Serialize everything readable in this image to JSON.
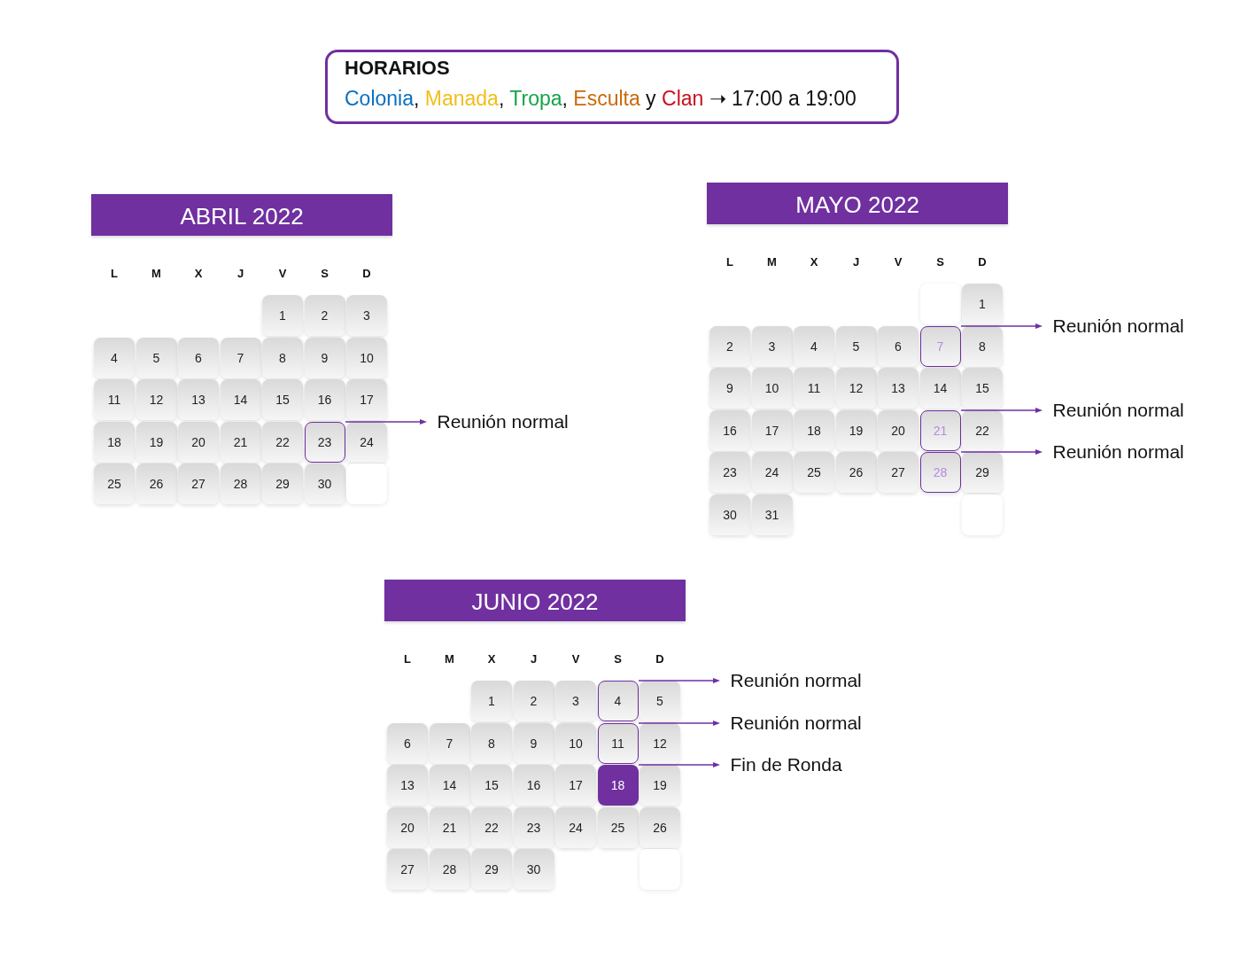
{
  "schedule": {
    "title": "HORARIOS",
    "segments": [
      {
        "text": "Colonia",
        "color": "#0b6fc2"
      },
      {
        "text": ", "
      },
      {
        "text": "Manada",
        "color": "#f2be1a"
      },
      {
        "text": ", "
      },
      {
        "text": "Tropa",
        "color": "#15a34a"
      },
      {
        "text": ", "
      },
      {
        "text": "Esculta",
        "color": "#c96a0c"
      },
      {
        "text": " y "
      },
      {
        "text": "Clan",
        "color": "#c8101e"
      },
      {
        "text": " ➝ 17:00 a 19:00"
      }
    ]
  },
  "months": [
    {
      "title": "ABRIL 2022",
      "weekdays": [
        "L",
        "M",
        "X",
        "J",
        "V",
        "S",
        "D"
      ],
      "days": [
        {
          "kind": "empty"
        },
        {
          "kind": "empty"
        },
        {
          "kind": "empty"
        },
        {
          "kind": "empty"
        },
        {
          "kind": "plain",
          "label": "1"
        },
        {
          "kind": "plain",
          "label": "2"
        },
        {
          "kind": "plain",
          "label": "3"
        },
        {
          "kind": "plain",
          "label": "4"
        },
        {
          "kind": "plain",
          "label": "5"
        },
        {
          "kind": "plain",
          "label": "6"
        },
        {
          "kind": "plain",
          "label": "7"
        },
        {
          "kind": "plain",
          "label": "8"
        },
        {
          "kind": "plain",
          "label": "9"
        },
        {
          "kind": "plain",
          "label": "10"
        },
        {
          "kind": "plain",
          "label": "11"
        },
        {
          "kind": "plain",
          "label": "12"
        },
        {
          "kind": "plain",
          "label": "13"
        },
        {
          "kind": "plain",
          "label": "14"
        },
        {
          "kind": "plain",
          "label": "15"
        },
        {
          "kind": "plain",
          "label": "16"
        },
        {
          "kind": "plain",
          "label": "17"
        },
        {
          "kind": "plain",
          "label": "18"
        },
        {
          "kind": "plain",
          "label": "19"
        },
        {
          "kind": "plain",
          "label": "20"
        },
        {
          "kind": "plain",
          "label": "21"
        },
        {
          "kind": "plain",
          "label": "22"
        },
        {
          "kind": "outlined",
          "label": "23",
          "note": "Reunión normal"
        },
        {
          "kind": "plain",
          "label": "24"
        },
        {
          "kind": "plain",
          "label": "25"
        },
        {
          "kind": "plain",
          "label": "26"
        },
        {
          "kind": "plain",
          "label": "27"
        },
        {
          "kind": "plain",
          "label": "28"
        },
        {
          "kind": "plain",
          "label": "29"
        },
        {
          "kind": "plain",
          "label": "30"
        },
        {
          "kind": "blank"
        }
      ]
    },
    {
      "title": "MAYO 2022",
      "weekdays": [
        "L",
        "M",
        "X",
        "J",
        "V",
        "S",
        "D"
      ],
      "days": [
        {
          "kind": "empty"
        },
        {
          "kind": "empty"
        },
        {
          "kind": "empty"
        },
        {
          "kind": "empty"
        },
        {
          "kind": "empty"
        },
        {
          "kind": "blank"
        },
        {
          "kind": "plain",
          "label": "1"
        },
        {
          "kind": "plain",
          "label": "2"
        },
        {
          "kind": "plain",
          "label": "3"
        },
        {
          "kind": "plain",
          "label": "4"
        },
        {
          "kind": "plain",
          "label": "5"
        },
        {
          "kind": "plain",
          "label": "6"
        },
        {
          "kind": "faded",
          "label": "7",
          "note": "Reunión normal"
        },
        {
          "kind": "plain",
          "label": "8"
        },
        {
          "kind": "plain",
          "label": "9"
        },
        {
          "kind": "plain",
          "label": "10"
        },
        {
          "kind": "plain",
          "label": "11"
        },
        {
          "kind": "plain",
          "label": "12"
        },
        {
          "kind": "plain",
          "label": "13"
        },
        {
          "kind": "plain",
          "label": "14"
        },
        {
          "kind": "plain",
          "label": "15"
        },
        {
          "kind": "plain",
          "label": "16"
        },
        {
          "kind": "plain",
          "label": "17"
        },
        {
          "kind": "plain",
          "label": "18"
        },
        {
          "kind": "plain",
          "label": "19"
        },
        {
          "kind": "plain",
          "label": "20"
        },
        {
          "kind": "faded",
          "label": "21",
          "note": "Reunión normal"
        },
        {
          "kind": "plain",
          "label": "22"
        },
        {
          "kind": "plain",
          "label": "23"
        },
        {
          "kind": "plain",
          "label": "24"
        },
        {
          "kind": "plain",
          "label": "25"
        },
        {
          "kind": "plain",
          "label": "26"
        },
        {
          "kind": "plain",
          "label": "27"
        },
        {
          "kind": "faded",
          "label": "28",
          "note": "Reunión normal"
        },
        {
          "kind": "plain",
          "label": "29"
        },
        {
          "kind": "plain",
          "label": "30"
        },
        {
          "kind": "plain",
          "label": "31"
        },
        {
          "kind": "empty"
        },
        {
          "kind": "empty"
        },
        {
          "kind": "empty"
        },
        {
          "kind": "empty"
        },
        {
          "kind": "blank"
        }
      ]
    },
    {
      "title": "JUNIO 2022",
      "weekdays": [
        "L",
        "M",
        "X",
        "J",
        "V",
        "S",
        "D"
      ],
      "days": [
        {
          "kind": "empty"
        },
        {
          "kind": "empty"
        },
        {
          "kind": "plain",
          "label": "1"
        },
        {
          "kind": "plain",
          "label": "2"
        },
        {
          "kind": "plain",
          "label": "3"
        },
        {
          "kind": "outlined",
          "label": "4",
          "note": "Reunión normal"
        },
        {
          "kind": "plain",
          "label": "5"
        },
        {
          "kind": "plain",
          "label": "6"
        },
        {
          "kind": "plain",
          "label": "7"
        },
        {
          "kind": "plain",
          "label": "8"
        },
        {
          "kind": "plain",
          "label": "9"
        },
        {
          "kind": "plain",
          "label": "10"
        },
        {
          "kind": "outlined",
          "label": "11",
          "note": "Reunión normal"
        },
        {
          "kind": "plain",
          "label": "12"
        },
        {
          "kind": "plain",
          "label": "13"
        },
        {
          "kind": "plain",
          "label": "14"
        },
        {
          "kind": "plain",
          "label": "15"
        },
        {
          "kind": "plain",
          "label": "16"
        },
        {
          "kind": "plain",
          "label": "17"
        },
        {
          "kind": "filled",
          "label": "18",
          "note": "Fin de Ronda"
        },
        {
          "kind": "plain",
          "label": "19"
        },
        {
          "kind": "plain",
          "label": "20"
        },
        {
          "kind": "plain",
          "label": "21"
        },
        {
          "kind": "plain",
          "label": "22"
        },
        {
          "kind": "plain",
          "label": "23"
        },
        {
          "kind": "plain",
          "label": "24"
        },
        {
          "kind": "plain",
          "label": "25"
        },
        {
          "kind": "plain",
          "label": "26"
        },
        {
          "kind": "plain",
          "label": "27"
        },
        {
          "kind": "plain",
          "label": "28"
        },
        {
          "kind": "plain",
          "label": "29"
        },
        {
          "kind": "plain",
          "label": "30"
        },
        {
          "kind": "empty"
        },
        {
          "kind": "empty"
        },
        {
          "kind": "blank"
        }
      ]
    }
  ]
}
